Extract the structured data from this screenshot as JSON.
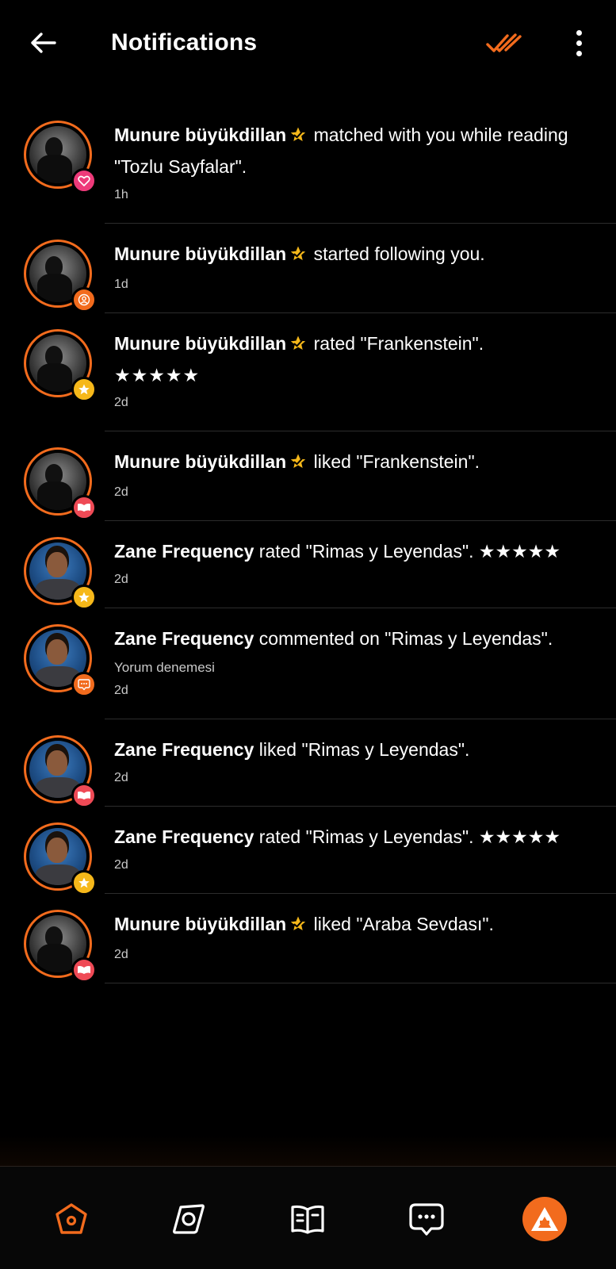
{
  "header": {
    "title": "Notifications"
  },
  "colors": {
    "accent": "#f26b1d",
    "background": "#000000",
    "verified": "#f6b81a"
  },
  "notifications": [
    {
      "avatar": "mono",
      "badge_icon": "heart-icon",
      "badge_color": "pink",
      "user": "Munure büyükdillan",
      "verified": true,
      "text": " matched with you while reading \"Tozlu Sayfalar\".",
      "stars": "",
      "sub": "",
      "time": "1h"
    },
    {
      "avatar": "mono",
      "badge_icon": "user-icon",
      "badge_color": "orange",
      "user": "Munure büyükdillan",
      "verified": true,
      "text": " started following you.",
      "stars": "",
      "sub": "",
      "time": "1d"
    },
    {
      "avatar": "mono",
      "badge_icon": "star-icon",
      "badge_color": "yellow",
      "user": "Munure büyükdillan",
      "verified": true,
      "text": " rated \"Frankenstein\".",
      "stars": "★★★★★",
      "sub": "",
      "time": "2d"
    },
    {
      "avatar": "mono",
      "badge_icon": "book-icon",
      "badge_color": "red",
      "user": "Munure büyükdillan",
      "verified": true,
      "text": " liked \"Frankenstein\".",
      "stars": "",
      "sub": "",
      "time": "2d"
    },
    {
      "avatar": "blue",
      "badge_icon": "star-icon",
      "badge_color": "yellow",
      "user": "Zane Frequency",
      "verified": false,
      "text": " rated \"Rimas y Leyendas\". ★★★★★",
      "stars": "",
      "sub": "",
      "time": "2d"
    },
    {
      "avatar": "blue",
      "badge_icon": "chat-icon",
      "badge_color": "orange",
      "user": "Zane Frequency",
      "verified": false,
      "text": " commented on \"Rimas y Leyendas\".",
      "stars": "",
      "sub": "Yorum denemesi",
      "time": "2d"
    },
    {
      "avatar": "blue",
      "badge_icon": "book-icon",
      "badge_color": "red",
      "user": "Zane Frequency",
      "verified": false,
      "text": " liked \"Rimas y Leyendas\".",
      "stars": "",
      "sub": "",
      "time": "2d"
    },
    {
      "avatar": "blue",
      "badge_icon": "star-icon",
      "badge_color": "yellow",
      "user": "Zane Frequency",
      "verified": false,
      "text": " rated \"Rimas y Leyendas\". ★★★★★",
      "stars": "",
      "sub": "",
      "time": "2d"
    },
    {
      "avatar": "mono",
      "badge_icon": "book-icon",
      "badge_color": "red",
      "user": "Munure büyükdillan",
      "verified": true,
      "text": " liked \"Araba Sevdası\".",
      "stars": "",
      "sub": "",
      "time": "2d"
    }
  ],
  "bottom_nav": [
    {
      "icon": "home-icon",
      "active": true
    },
    {
      "icon": "discover-icon",
      "active": false
    },
    {
      "icon": "library-icon",
      "active": false
    },
    {
      "icon": "messages-icon",
      "active": false
    },
    {
      "icon": "profile-icon",
      "active": false
    }
  ]
}
